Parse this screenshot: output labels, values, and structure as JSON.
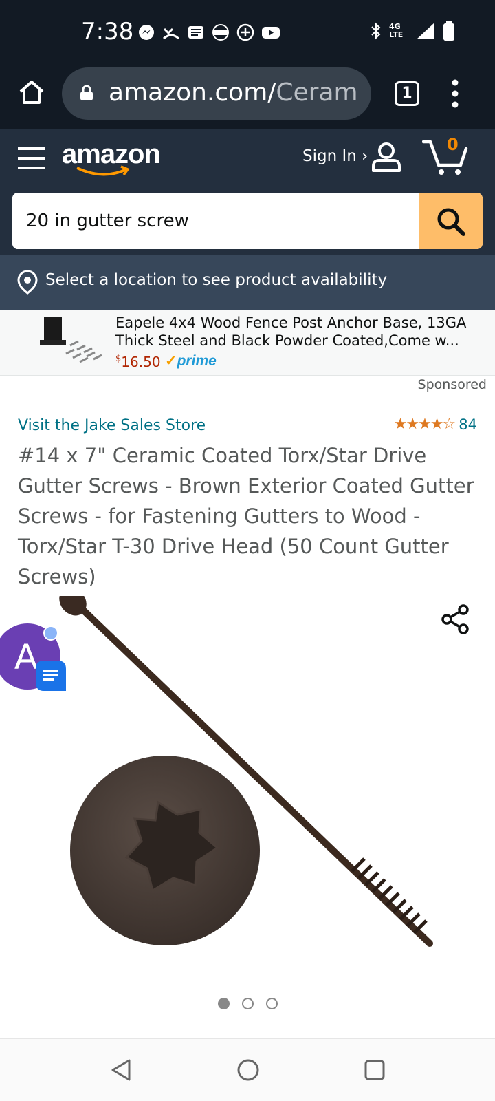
{
  "status_bar": {
    "time": "7:38",
    "network": "4G LTE"
  },
  "browser": {
    "url_host": "amazon.com/",
    "url_path": "Cerami",
    "tab_count": "1"
  },
  "header": {
    "logo": "amazon",
    "signin_label": "Sign In ›",
    "cart_count": "0",
    "search_value": "20 in gutter screw"
  },
  "location": {
    "text": "Select a location to see product availability"
  },
  "ad": {
    "title": "Eapele 4x4 Wood Fence Post Anchor Base, 13GA Thick Steel and Black Powder Coated,Come w...",
    "price_currency": "$",
    "price": "16.50",
    "prime_label": "prime",
    "sponsored_label": "Sponsored"
  },
  "product": {
    "store_link": "Visit the Jake Sales Store",
    "stars": "★★★★☆",
    "rating_count": "84",
    "rating": 4.5,
    "title": "#14 x 7\" Ceramic Coated Torx/Star Drive Gutter Screws - Brown Exterior Coated Gutter Screws - for Fastening Gutters to Wood - Torx/Star T-30 Drive Head (50 Count Gutter Screws)",
    "image_count": 3,
    "image_index": 1
  },
  "chat_head": {
    "initial": "A"
  },
  "colors": {
    "header_dark": "#232f3e",
    "browser_dark": "#121a24",
    "search_button": "#febd69",
    "link": "#007185",
    "star": "#de7921",
    "price": "#b12704",
    "prime": "#1f9ad6"
  }
}
